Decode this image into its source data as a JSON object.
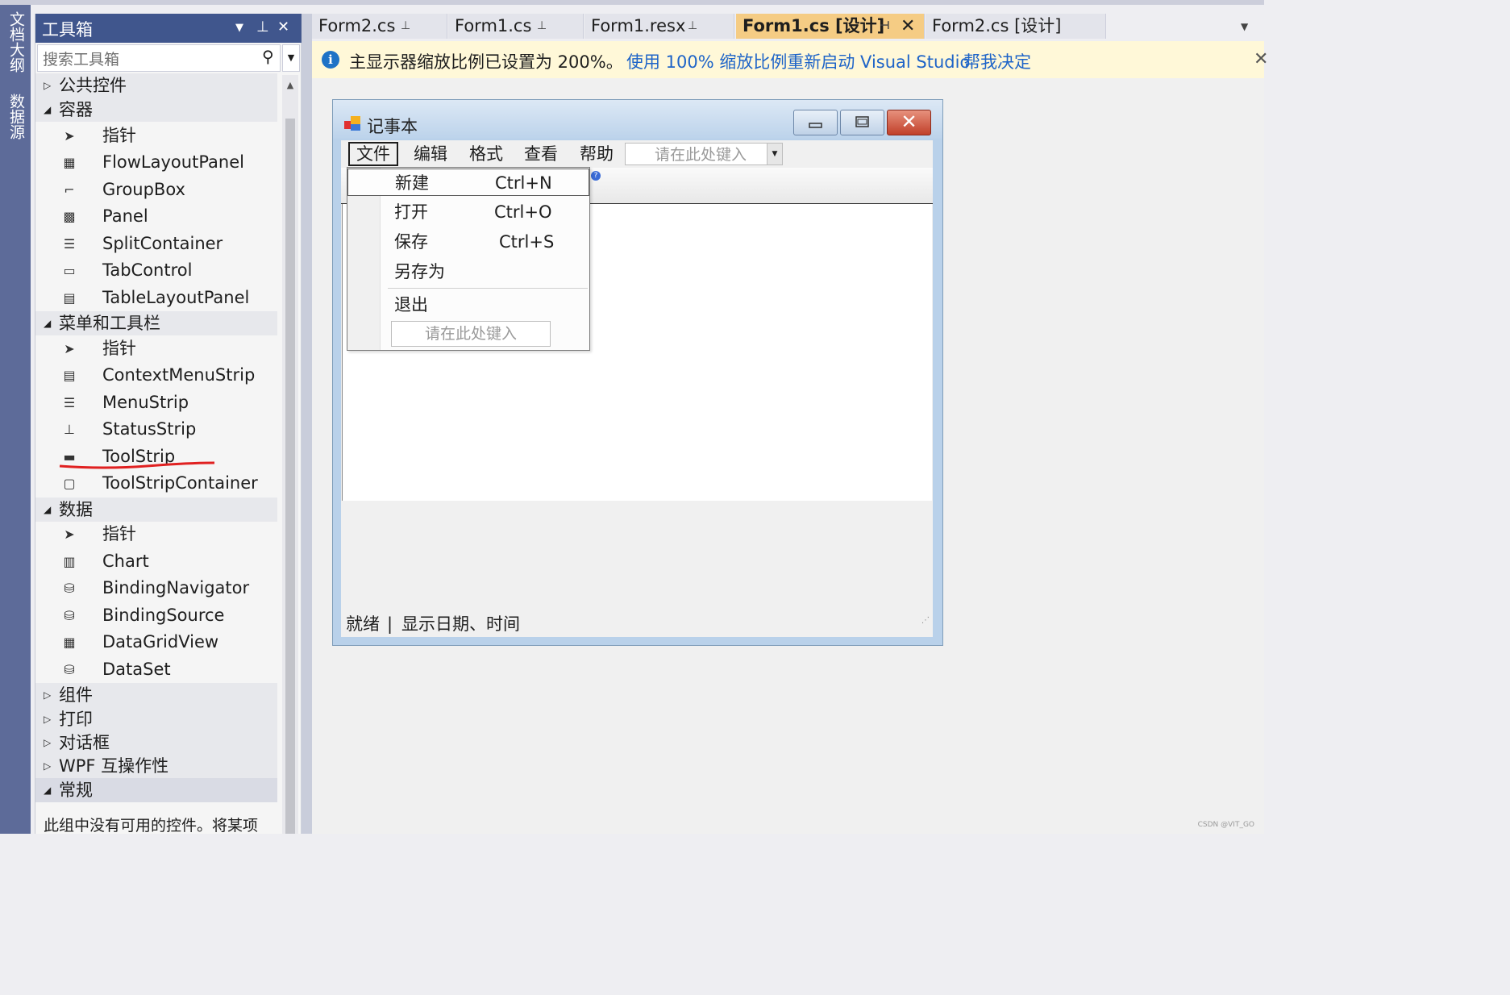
{
  "left_dock": {
    "tabs": [
      "文档大纲",
      "数据源"
    ]
  },
  "toolbox": {
    "title": "工具箱",
    "search_placeholder": "搜索工具箱",
    "categories": [
      {
        "label": "公共控件",
        "expanded": false,
        "items": []
      },
      {
        "label": "容器",
        "expanded": true,
        "items": [
          {
            "label": "指针",
            "icon": "pointer-icon"
          },
          {
            "label": "FlowLayoutPanel",
            "icon": "flowlayoutpanel-icon"
          },
          {
            "label": "GroupBox",
            "icon": "groupbox-icon"
          },
          {
            "label": "Panel",
            "icon": "panel-icon"
          },
          {
            "label": "SplitContainer",
            "icon": "splitcontainer-icon"
          },
          {
            "label": "TabControl",
            "icon": "tabcontrol-icon"
          },
          {
            "label": "TableLayoutPanel",
            "icon": "tablelayoutpanel-icon"
          }
        ]
      },
      {
        "label": "菜单和工具栏",
        "expanded": true,
        "items": [
          {
            "label": "指针",
            "icon": "pointer-icon"
          },
          {
            "label": "ContextMenuStrip",
            "icon": "contextmenustrip-icon"
          },
          {
            "label": "MenuStrip",
            "icon": "menustrip-icon"
          },
          {
            "label": "StatusStrip",
            "icon": "statusstrip-icon"
          },
          {
            "label": "ToolStrip",
            "icon": "toolstrip-icon"
          },
          {
            "label": "ToolStripContainer",
            "icon": "toolstripcontainer-icon"
          }
        ]
      },
      {
        "label": "数据",
        "expanded": true,
        "items": [
          {
            "label": "指针",
            "icon": "pointer-icon"
          },
          {
            "label": "Chart",
            "icon": "chart-icon"
          },
          {
            "label": "BindingNavigator",
            "icon": "bindingnavigator-icon"
          },
          {
            "label": "BindingSource",
            "icon": "bindingsource-icon"
          },
          {
            "label": "DataGridView",
            "icon": "datagridview-icon"
          },
          {
            "label": "DataSet",
            "icon": "dataset-icon"
          }
        ]
      },
      {
        "label": "组件",
        "expanded": false,
        "items": []
      },
      {
        "label": "打印",
        "expanded": false,
        "items": []
      },
      {
        "label": "对话框",
        "expanded": false,
        "items": []
      },
      {
        "label": "WPF 互操作性",
        "expanded": false,
        "items": []
      },
      {
        "label": "常规",
        "expanded": true,
        "items": []
      }
    ],
    "empty_note": "此组中没有可用的控件。将某项"
  },
  "tabs": [
    {
      "label": "Form2.cs",
      "active": false
    },
    {
      "label": "Form1.cs",
      "active": false
    },
    {
      "label": "Form1.resx",
      "active": false
    },
    {
      "label": "Form1.cs [设计]",
      "active": true
    },
    {
      "label": "Form2.cs [设计]",
      "active": false
    }
  ],
  "infobar": {
    "message": "主显示器缩放比例已设置为 200%。",
    "link1": "使用 100% 缩放比例重新启动 Visual Studio",
    "link2": "帮我决定"
  },
  "form": {
    "title": "记事本",
    "menu": [
      "文件",
      "编辑",
      "格式",
      "查看",
      "帮助"
    ],
    "menu_type_here": "请在此处键入",
    "file_menu": [
      {
        "label": "新建",
        "shortcut": "Ctrl+N"
      },
      {
        "label": "打开",
        "shortcut": "Ctrl+O"
      },
      {
        "label": "保存",
        "shortcut": "Ctrl+S"
      },
      {
        "label": "另存为",
        "shortcut": ""
      },
      {
        "label": "退出",
        "shortcut": ""
      }
    ],
    "file_menu_type_here": "请在此处键入",
    "status": {
      "ready": "就绪",
      "sep": "|",
      "datetime": "显示日期、时间"
    }
  },
  "watermark": "CSDN @VIT_GO",
  "colors": {
    "accent": "#40568D",
    "active_tab": "#F5CC84",
    "link": "#1E64C8",
    "infobar": "#FFF8D8",
    "annotation": "#E02020"
  }
}
